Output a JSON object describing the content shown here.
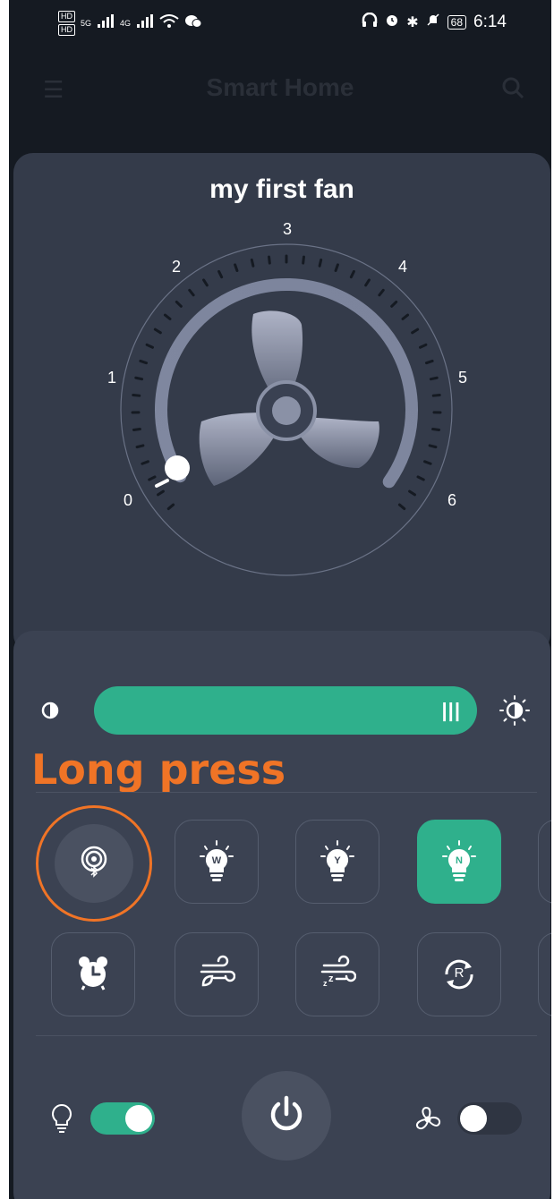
{
  "status_bar": {
    "hd1": "HD",
    "hd2": "HD",
    "net1": "5G",
    "net2": "4G",
    "battery": "68",
    "time": "6:14"
  },
  "app_bar": {
    "title": "Smart Home",
    "menu_icon": "menu-icon",
    "search_icon": "search-icon"
  },
  "device": {
    "name": "my first fan",
    "speed_labels": [
      "0",
      "1",
      "2",
      "3",
      "4",
      "5",
      "6"
    ],
    "current_speed": 0
  },
  "brightness": {
    "grip": "|||",
    "level": 1.0
  },
  "annotation": {
    "text": "Long press",
    "color": "#f07426"
  },
  "mode_buttons": [
    {
      "id": "bluetooth",
      "icon": "bluetooth-broadcast-icon",
      "label": ""
    },
    {
      "id": "warm",
      "icon": "bulb-icon",
      "label": "W"
    },
    {
      "id": "yellow",
      "icon": "bulb-icon",
      "label": "Y"
    },
    {
      "id": "natural",
      "icon": "bulb-icon",
      "label": "N",
      "active": true
    }
  ],
  "function_buttons": [
    {
      "id": "timer",
      "icon": "alarm-clock-icon"
    },
    {
      "id": "natural-wind",
      "icon": "leaf-wind-icon"
    },
    {
      "id": "sleep-wind",
      "icon": "sleep-wind-icon"
    },
    {
      "id": "reverse",
      "icon": "reverse-icon",
      "label": "R"
    }
  ],
  "bottom_controls": {
    "light_toggle_on": true,
    "fan_toggle_on": false
  },
  "colors": {
    "accent": "#2fb08c",
    "card": "#343b4a",
    "background": "#151a22"
  }
}
